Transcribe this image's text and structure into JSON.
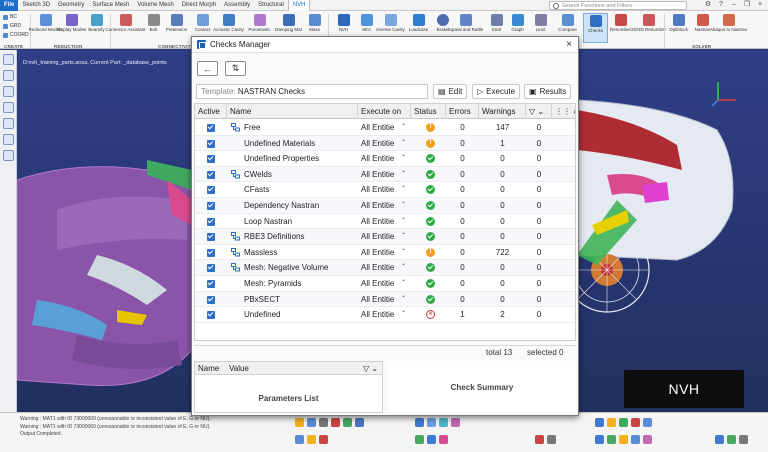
{
  "menubar": {
    "tabs": [
      "File",
      "Sketch 3D",
      "Geometry",
      "Surface Mesh",
      "Volume Mesh",
      "Direct Morph",
      "Assembly",
      "Structural",
      "NVH"
    ],
    "active_tab": "NVH",
    "search_placeholder": "Search Functions and Filters"
  },
  "ribbon": {
    "small_items": [
      "BC",
      "GRD",
      "COORD"
    ],
    "buttons": [
      "Reduced Models",
      "Display Modes",
      "Beamify",
      "Connector Assistant",
      "Bolt",
      "Pretension",
      "Contact",
      "Acoustic Cavity",
      "Poroelastic",
      "Damping Mat",
      "Mass",
      "NVH",
      "SEA",
      "Inverse Cavity",
      "Loadcase",
      "Brake",
      "Squeal and Rattle",
      "Stick",
      "Graph",
      "Limit",
      "Compare",
      "Checks",
      "Renumber",
      "2D/3D Renumber",
      "Optiblock",
      "Nastran",
      "Abaqus to Nastran"
    ],
    "selected_button": "Checks",
    "groups": [
      "CREATE",
      "REDUCTION",
      "CONNECTIVITY",
      "SOLVER"
    ]
  },
  "viewport": {
    "info_text": "D:nvh_training_parts.ansa,  Current Part: _database_points",
    "badge": "NVH"
  },
  "message_log": [
    "Warning : MAT1 with ID 73000009 (unreasonable or inconsistent value of E, G or NU).",
    "Warning : MAT1 with ID 73000060 (unreasonable or inconsistent value of E, G or NU).",
    "Output Completed."
  ],
  "dialog": {
    "title": "Checks Manager",
    "close_label": "×",
    "back_icon": "←",
    "filter_icon": "⇅",
    "template_label": "Template:",
    "template_value": "NASTRAN Checks",
    "edit_label": "Edit",
    "execute_label": "Execute",
    "results_label": "Results",
    "columns": [
      "Active",
      "Name",
      "Execute on",
      "Status",
      "Errors",
      "Warnings"
    ],
    "rows": [
      {
        "name": "Free",
        "group": true,
        "execute_on": "All Entitie",
        "status": "warn",
        "errors": "0",
        "warnings": "147",
        "extra": "0"
      },
      {
        "name": "Undefined Materials",
        "group": false,
        "execute_on": "All Entitie",
        "status": "warn",
        "errors": "0",
        "warnings": "1",
        "extra": "0"
      },
      {
        "name": "Undefined Properties",
        "group": false,
        "execute_on": "All Entitie",
        "status": "ok",
        "errors": "0",
        "warnings": "0",
        "extra": "0"
      },
      {
        "name": "CWelds",
        "group": true,
        "execute_on": "All Entitie",
        "status": "ok",
        "errors": "0",
        "warnings": "0",
        "extra": "0"
      },
      {
        "name": "CFasts",
        "group": false,
        "execute_on": "All Entitie",
        "status": "ok",
        "errors": "0",
        "warnings": "0",
        "extra": "0"
      },
      {
        "name": "Dependency Nastran",
        "group": false,
        "execute_on": "All Entitie",
        "status": "ok",
        "errors": "0",
        "warnings": "0",
        "extra": "0"
      },
      {
        "name": "Loop Nastran",
        "group": false,
        "execute_on": "All Entitie",
        "status": "ok",
        "errors": "0",
        "warnings": "0",
        "extra": "0"
      },
      {
        "name": "RBE3 Definitions",
        "group": true,
        "execute_on": "All Entitie",
        "status": "ok",
        "errors": "0",
        "warnings": "0",
        "extra": "0"
      },
      {
        "name": "Massless",
        "group": true,
        "execute_on": "All Entitie",
        "status": "warn",
        "errors": "0",
        "warnings": "722",
        "extra": "0"
      },
      {
        "name": "Mesh: Negative Volume",
        "group": true,
        "execute_on": "All Entitie",
        "status": "ok",
        "errors": "0",
        "warnings": "0",
        "extra": "0"
      },
      {
        "name": "Mesh: Pyramids",
        "group": false,
        "execute_on": "All Entitie",
        "status": "ok",
        "errors": "0",
        "warnings": "0",
        "extra": "0"
      },
      {
        "name": "PBxSECT",
        "group": false,
        "execute_on": "All Entitie",
        "status": "ok",
        "errors": "0",
        "warnings": "0",
        "extra": "0"
      },
      {
        "name": "Undefined",
        "group": false,
        "execute_on": "All Entitie",
        "status": "err",
        "errors": "1",
        "warnings": "2",
        "extra": "0"
      }
    ],
    "total_label": "total 13",
    "selected_label": "selected 0",
    "params_columns": [
      "Name",
      "Value"
    ],
    "params_title": "Parameters List",
    "summary_title": "Check Summary"
  },
  "colors": {
    "accent": "#1c6fc9",
    "ok": "#2fa846",
    "warn": "#f2a01d",
    "error": "#d33b3b"
  }
}
